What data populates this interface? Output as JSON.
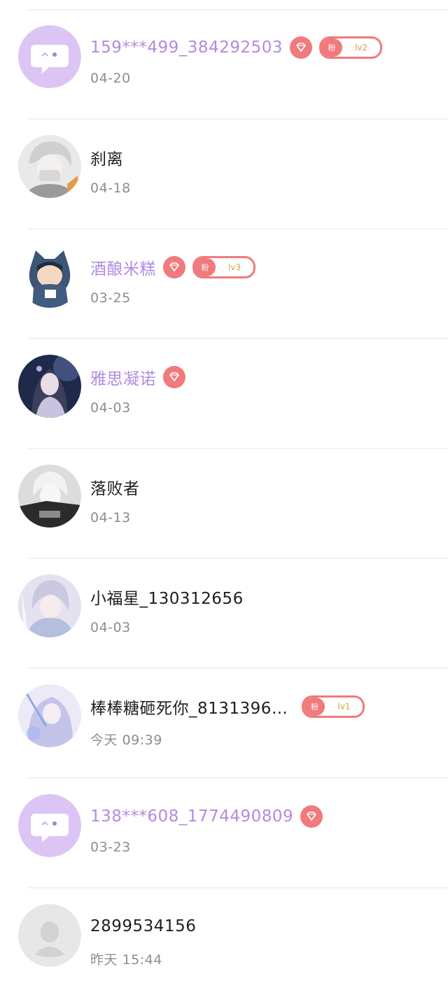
{
  "colors": {
    "vip_name": "#b18be0",
    "normal_name": "#1f1f1f",
    "time": "#8d8d8d",
    "badge": "#f07a7c",
    "fan_level_text": "#d9a23f"
  },
  "fan_badge_tag": "粉",
  "contacts": [
    {
      "name": "159***499_384292503",
      "time": "04-20",
      "vip": true,
      "fan_level": "lv2",
      "avatar_icon": "chat-bubble-avatar-icon"
    },
    {
      "name": "刹离",
      "time": "04-18",
      "vip": false,
      "fan_level": null,
      "avatar_icon": "user-photo-avatar"
    },
    {
      "name": "酒酿米糕",
      "time": "03-25",
      "vip": true,
      "fan_level": "lv3",
      "avatar_icon": "user-photo-avatar"
    },
    {
      "name": "雅思凝诺",
      "time": "04-03",
      "vip": true,
      "fan_level": null,
      "avatar_icon": "user-photo-avatar"
    },
    {
      "name": "落败者",
      "time": "04-13",
      "vip": false,
      "fan_level": null,
      "avatar_icon": "user-photo-avatar"
    },
    {
      "name": "小福星_130312656",
      "time": "04-03",
      "vip": false,
      "fan_level": null,
      "avatar_icon": "user-photo-avatar"
    },
    {
      "name": "棒棒糖砸死你_8131396…",
      "time": "今天 09:39",
      "vip": false,
      "fan_level": "lv1",
      "avatar_icon": "user-photo-avatar"
    },
    {
      "name": "138***608_1774490809",
      "time": "03-23",
      "vip": true,
      "fan_level": null,
      "avatar_icon": "chat-bubble-avatar-icon"
    },
    {
      "name": "2899534156",
      "time": "昨天 15:44",
      "vip": false,
      "fan_level": null,
      "avatar_icon": "default-person-avatar-icon"
    }
  ]
}
